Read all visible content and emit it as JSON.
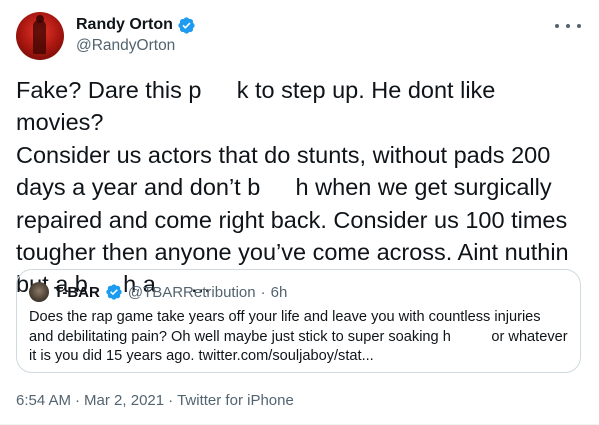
{
  "author": {
    "display_name": "Randy Orton",
    "handle": "@RandyOrton",
    "verified": true
  },
  "tweet": {
    "text": "Fake? Dare this p  k to step up. He dont like movies?\nConsider us actors that do stunts, without pads 200\ndays a year and don’t b  h when we get surgically\nrepaired and come right back. Consider us 100 times\ntougher then anyone you’ve come across. Aint nuthin\nbut a b  h a  ..."
  },
  "quoted_tweet": {
    "display_name": "T-BAR",
    "handle": "@TBARRetribution",
    "separator": "·",
    "time": "6h",
    "verified": true,
    "text": "Does the rap game take years off your life and leave you with countless injuries\nand debilitating pain? Oh well maybe just stick to super soaking h    or whatever\nit is you did 15 years ago. twitter.com/souljaboy/stat..."
  },
  "meta": {
    "time": "6:54 AM",
    "sep1": "·",
    "date": "Mar 2, 2021",
    "sep2": "·",
    "source": "Twitter for iPhone"
  },
  "colors": {
    "verified_badge": "#1d9bf0",
    "secondary_text": "#536471",
    "border": "#cfd9de"
  },
  "icons": {
    "verified": "verified-badge-icon",
    "more": "more-options-icon"
  }
}
